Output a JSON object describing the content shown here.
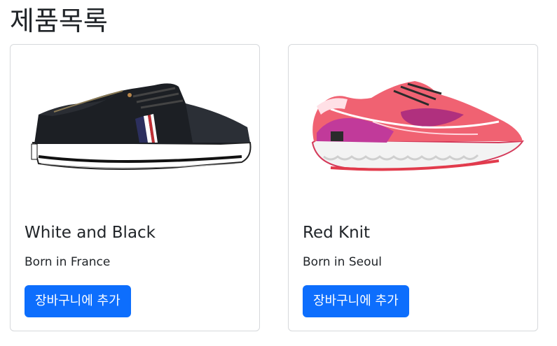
{
  "page": {
    "title": "제품목록"
  },
  "products": [
    {
      "title": "White and Black",
      "description": "Born in France",
      "button_label": "장바구니에 추가",
      "image_icon": "black-sneaker-image"
    },
    {
      "title": "Red Knit",
      "description": "Born in Seoul",
      "button_label": "장바구니에 추가",
      "image_icon": "red-running-shoe-image"
    }
  ],
  "colors": {
    "button_bg": "#0d6efd",
    "button_text": "#ffffff",
    "card_border": "#d6d8db",
    "text": "#212529"
  }
}
